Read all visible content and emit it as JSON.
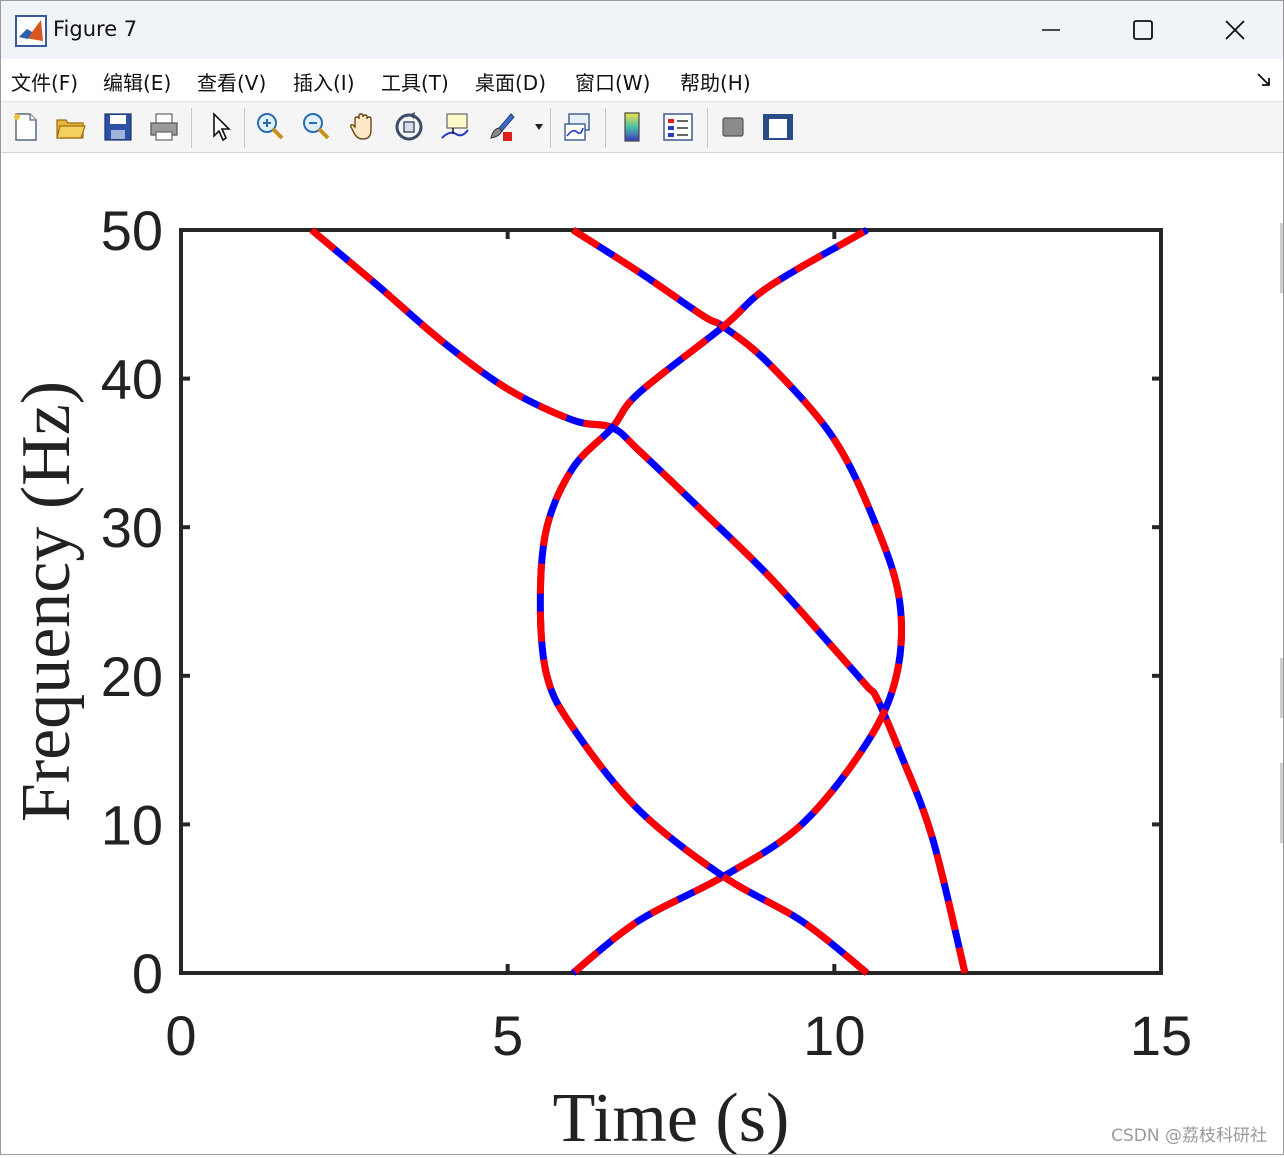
{
  "window": {
    "title": "Figure 7",
    "controls": {
      "minimize": "minimize",
      "maximize": "maximize",
      "close": "close"
    }
  },
  "menu": {
    "items": [
      {
        "label": "文件(F)"
      },
      {
        "label": "编辑(E)"
      },
      {
        "label": "查看(V)"
      },
      {
        "label": "插入(I)"
      },
      {
        "label": "工具(T)"
      },
      {
        "label": "桌面(D)"
      },
      {
        "label": "窗口(W)"
      },
      {
        "label": "帮助(H)"
      }
    ]
  },
  "toolbar": {
    "buttons": [
      {
        "icon": "new-figure-icon"
      },
      {
        "icon": "open-file-icon"
      },
      {
        "icon": "save-icon"
      },
      {
        "icon": "print-icon"
      },
      {
        "icon": "pointer-icon"
      },
      {
        "icon": "zoom-in-icon"
      },
      {
        "icon": "zoom-out-icon"
      },
      {
        "icon": "pan-hand-icon"
      },
      {
        "icon": "rotate-3d-icon"
      },
      {
        "icon": "data-cursor-icon"
      },
      {
        "icon": "brush-icon"
      },
      {
        "icon": "link-plot-icon"
      },
      {
        "icon": "colorbar-icon"
      },
      {
        "icon": "legend-icon"
      },
      {
        "icon": "hide-plot-tools-icon"
      },
      {
        "icon": "show-plot-tools-icon"
      }
    ]
  },
  "watermark": "CSDN @荔枝科研社",
  "colors": {
    "primary_curve": "#0000ff",
    "dash_overlay": "#ff0000",
    "axes": "#262626"
  },
  "chart_data": {
    "type": "line",
    "title": "",
    "xlabel": "Time (s)",
    "ylabel": "Frequency (Hz)",
    "xlim": [
      0,
      15
    ],
    "ylim": [
      0,
      50
    ],
    "xticks": [
      0,
      5,
      10,
      15
    ],
    "yticks": [
      0,
      10,
      20,
      30,
      40,
      50
    ],
    "tick_labels_x": [
      "0",
      "5",
      "10",
      "15"
    ],
    "tick_labels_y": [
      "0",
      "10",
      "20",
      "30",
      "40",
      "50"
    ],
    "grid": false,
    "line_style": "solid blue with red dashed overlay",
    "series": [
      {
        "x": [
          2.0,
          3.0,
          4.0,
          5.0,
          6.0,
          6.6,
          7.0,
          8.0,
          9.0,
          10.0,
          10.5,
          10.65,
          11.0,
          11.5,
          12.0
        ],
        "y": [
          50,
          46.3,
          42.5,
          39.3,
          37.2,
          36.7,
          35.2,
          31.0,
          26.7,
          21.8,
          19.3,
          18.5,
          14.9,
          9.1,
          0
        ]
      },
      {
        "x": [
          6.0,
          7.0,
          8.0,
          8.3,
          9.0,
          10.0,
          10.65,
          11.0,
          10.95,
          10.5,
          9.5,
          8.3,
          7.0,
          6.0
        ],
        "y": [
          50,
          47.2,
          44.2,
          43.5,
          41.0,
          35.9,
          30.0,
          25.0,
          20.0,
          15.5,
          10.0,
          6.5,
          3.5,
          0
        ]
      },
      {
        "x": [
          10.5,
          9.5,
          8.3,
          7.0,
          6.0,
          5.6,
          5.5,
          5.6,
          6.0,
          6.6,
          7.0,
          8.3,
          9.0,
          10.5
        ],
        "y": [
          0,
          3.5,
          6.5,
          11.0,
          16.5,
          20.0,
          25.0,
          30.0,
          34.0,
          36.7,
          39.0,
          43.5,
          46.2,
          50
        ]
      }
    ]
  }
}
